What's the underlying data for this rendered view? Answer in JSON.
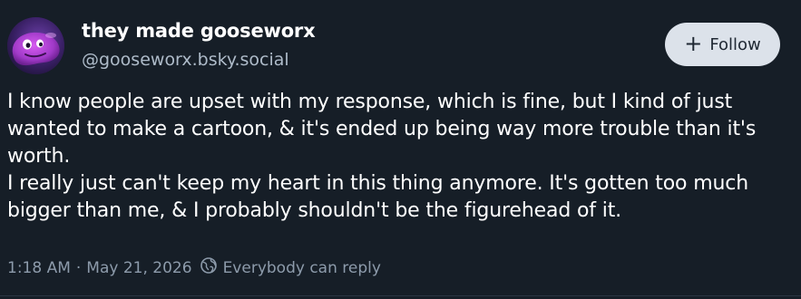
{
  "author": {
    "display_name": "they made gooseworx",
    "handle": "@gooseworx.bsky.social"
  },
  "follow_button": {
    "icon": "plus-icon",
    "label": "Follow"
  },
  "post": {
    "paragraphs": [
      "I know people are upset with my response, which is fine, but I kind of just wanted to make a cartoon, & it's ended up being way more trouble than it's worth.",
      "I really just can't keep my heart in this thing anymore. It's gotten too much bigger than me, & I probably shouldn't be the figurehead of it."
    ]
  },
  "meta": {
    "time": "1:18 AM",
    "separator": "·",
    "date": "May 21, 2026",
    "reply_icon": "earth-icon",
    "reply_setting": "Everybody can reply"
  },
  "colors": {
    "background": "#161e27",
    "text": "#ffffff",
    "secondary_text": "#aebbc9",
    "muted_text": "#8d9bab",
    "button_bg": "#dce2ea"
  }
}
